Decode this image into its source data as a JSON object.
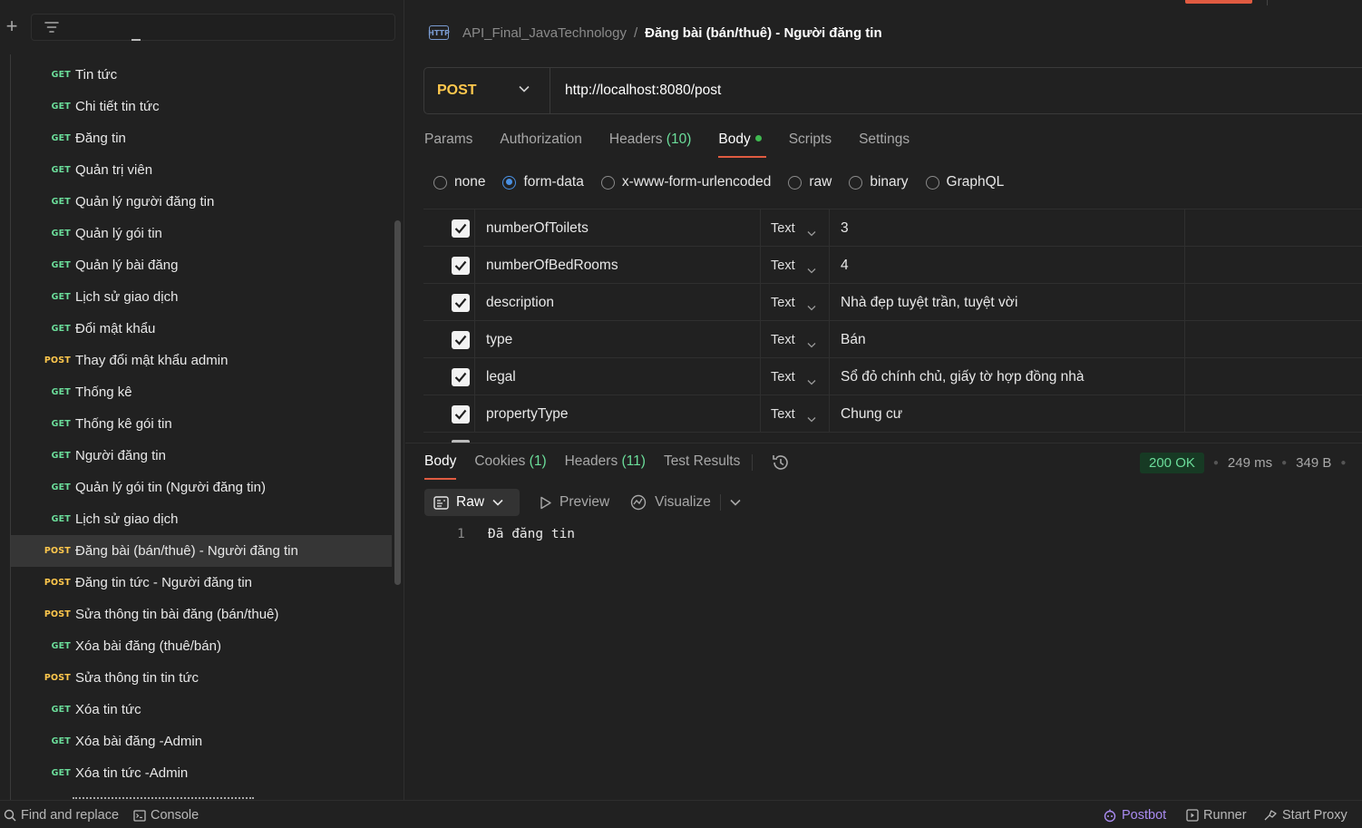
{
  "sidebar": {
    "requests": [
      {
        "method": "GET",
        "name": "Tin tức"
      },
      {
        "method": "GET",
        "name": "Chi tiết tin tức"
      },
      {
        "method": "GET",
        "name": "Đăng tin"
      },
      {
        "method": "GET",
        "name": "Quản trị viên"
      },
      {
        "method": "GET",
        "name": "Quản lý người đăng tin"
      },
      {
        "method": "GET",
        "name": "Quản lý gói tin"
      },
      {
        "method": "GET",
        "name": "Quản lý bài đăng"
      },
      {
        "method": "GET",
        "name": "Lịch sử giao dịch"
      },
      {
        "method": "GET",
        "name": "Đổi mật khẩu"
      },
      {
        "method": "POST",
        "name": "Thay đổi mật khẩu admin"
      },
      {
        "method": "GET",
        "name": "Thống kê"
      },
      {
        "method": "GET",
        "name": "Thống kê gói tin"
      },
      {
        "method": "GET",
        "name": "Người đăng tin"
      },
      {
        "method": "GET",
        "name": "Quản lý gói tin (Người đăng tin)"
      },
      {
        "method": "GET",
        "name": "Lịch sử giao dịch"
      },
      {
        "method": "POST",
        "name": "Đăng bài (bán/thuê) - Người đăng tin",
        "active": true
      },
      {
        "method": "POST",
        "name": "Đăng tin tức - Người đăng tin"
      },
      {
        "method": "POST",
        "name": "Sửa thông tin bài đăng (bán/thuê)"
      },
      {
        "method": "GET",
        "name": "Xóa bài đăng (thuê/bán)"
      },
      {
        "method": "POST",
        "name": "Sửa thông tin tin tức"
      },
      {
        "method": "GET",
        "name": "Xóa tin tức"
      },
      {
        "method": "GET",
        "name": "Xóa bài đăng -Admin"
      },
      {
        "method": "GET",
        "name": "Xóa tin tức -Admin"
      }
    ]
  },
  "header": {
    "icon_text": "HTTP",
    "collection": "API_Final_JavaTechnology",
    "separator": "/",
    "title": "Đăng bài (bán/thuê) - Người đăng tin"
  },
  "request": {
    "method": "POST",
    "url": "http://localhost:8080/post"
  },
  "request_tabs": [
    {
      "label": "Params",
      "count": ""
    },
    {
      "label": "Authorization",
      "count": ""
    },
    {
      "label": "Headers",
      "count": "(10)"
    },
    {
      "label": "Body",
      "count": "",
      "active": true
    },
    {
      "label": "Scripts",
      "count": ""
    },
    {
      "label": "Settings",
      "count": ""
    }
  ],
  "body_modes": [
    {
      "label": "none",
      "selected": false
    },
    {
      "label": "form-data",
      "selected": true
    },
    {
      "label": "x-www-form-urlencoded",
      "selected": false
    },
    {
      "label": "raw",
      "selected": false
    },
    {
      "label": "binary",
      "selected": false
    },
    {
      "label": "GraphQL",
      "selected": false
    }
  ],
  "form_data": [
    {
      "key": "numberOfToilets",
      "type": "Text",
      "value": "3",
      "checked": true
    },
    {
      "key": "numberOfBedRooms",
      "type": "Text",
      "value": "4",
      "checked": true
    },
    {
      "key": "description",
      "type": "Text",
      "value": "Nhà đẹp tuyệt trần, tuyệt vời",
      "checked": true
    },
    {
      "key": "type",
      "type": "Text",
      "value": "Bán",
      "checked": true
    },
    {
      "key": "legal",
      "type": "Text",
      "value": "Sổ đỏ chính chủ, giấy tờ hợp đồng nhà",
      "checked": true
    },
    {
      "key": "propertyType",
      "type": "Text",
      "value": "Chung cư",
      "checked": true
    }
  ],
  "response": {
    "tabs": [
      {
        "label": "Body",
        "count": "",
        "active": true
      },
      {
        "label": "Cookies",
        "count": "(1)"
      },
      {
        "label": "Headers",
        "count": "(11)"
      },
      {
        "label": "Test Results",
        "count": ""
      }
    ],
    "status": "200 OK",
    "time": "249 ms",
    "size": "349 B",
    "toolbar": {
      "raw": "Raw",
      "preview": "Preview",
      "visualize": "Visualize"
    },
    "lines": [
      {
        "n": "1",
        "text": "Đã đăng tin"
      }
    ]
  },
  "statusbar": {
    "find_replace": "Find and replace",
    "console": "Console",
    "postbot": "Postbot",
    "runner": "Runner",
    "start_proxy": "Start Proxy"
  },
  "colors": {
    "get": "#6bdd9a",
    "post": "#ffc84d",
    "accent": "#e05b41",
    "status_ok": "#6bdd9a",
    "postbot": "#a98bf0"
  }
}
